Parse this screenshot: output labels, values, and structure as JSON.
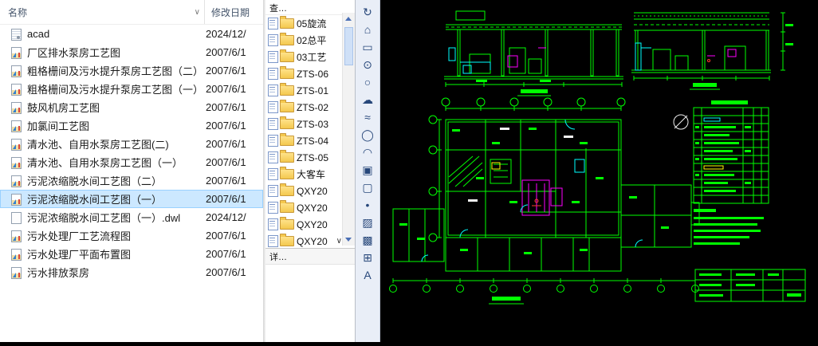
{
  "file_list": {
    "columns": {
      "name": "名称",
      "date": "修改日期"
    },
    "filter_glyph": "∨",
    "rows": [
      {
        "name": "acad",
        "date": "2024/12/",
        "icon": "acad"
      },
      {
        "name": "厂区排水泵房工艺图",
        "date": "2007/6/1",
        "icon": "dwg"
      },
      {
        "name": "粗格栅间及污水提升泵房工艺图（二）",
        "date": "2007/6/1",
        "icon": "dwg"
      },
      {
        "name": "粗格栅间及污水提升泵房工艺图（一）",
        "date": "2007/6/1",
        "icon": "dwg"
      },
      {
        "name": "鼓风机房工艺图",
        "date": "2007/6/1",
        "icon": "dwg"
      },
      {
        "name": "加氯间工艺图",
        "date": "2007/6/1",
        "icon": "dwg"
      },
      {
        "name": "清水池、自用水泵房工艺图(二)",
        "date": "2007/6/1",
        "icon": "dwg"
      },
      {
        "name": "清水池、自用水泵房工艺图（一）",
        "date": "2007/6/1",
        "icon": "dwg"
      },
      {
        "name": "污泥浓缩脱水间工艺图（二）",
        "date": "2007/6/1",
        "icon": "dwg"
      },
      {
        "name": "污泥浓缩脱水间工艺图（一）",
        "date": "2007/6/1",
        "icon": "dwg",
        "selected": true
      },
      {
        "name": "污泥浓缩脱水间工艺图（一）.dwl",
        "date": "2024/12/",
        "icon": "dwl"
      },
      {
        "name": "污水处理厂工艺流程图",
        "date": "2007/6/1",
        "icon": "dwg"
      },
      {
        "name": "污水处理厂平面布置图",
        "date": "2007/6/1",
        "icon": "dwg"
      },
      {
        "name": "污水排放泵房",
        "date": "2007/6/1",
        "icon": "dwg"
      }
    ]
  },
  "tree_panel": {
    "header": "查…",
    "details_header": "详…",
    "chevron_glyph": "∨",
    "items": [
      {
        "label": "05旋流"
      },
      {
        "label": "02总平"
      },
      {
        "label": "03工艺"
      },
      {
        "label": "ZTS-06"
      },
      {
        "label": "ZTS-01"
      },
      {
        "label": "ZTS-02"
      },
      {
        "label": "ZTS-03"
      },
      {
        "label": "ZTS-04"
      },
      {
        "label": "ZTS-05"
      },
      {
        "label": "大客车"
      },
      {
        "label": "QXY20"
      },
      {
        "label": "QXY20"
      },
      {
        "label": "QXY20"
      },
      {
        "label": "QXY20",
        "chevron": true
      }
    ]
  },
  "cad_toolbar": {
    "icons": [
      {
        "name": "orbit-icon",
        "glyph": "↻"
      },
      {
        "name": "home-icon",
        "glyph": "⌂"
      },
      {
        "name": "zoom-window-icon",
        "glyph": "▭"
      },
      {
        "name": "zoom-icon",
        "glyph": "⊙"
      },
      {
        "name": "circle-icon",
        "glyph": "○"
      },
      {
        "name": "revcloud-icon",
        "glyph": "☁"
      },
      {
        "name": "spline-icon",
        "glyph": "≈"
      },
      {
        "name": "ellipse-icon",
        "glyph": "◯"
      },
      {
        "name": "arc-icon",
        "glyph": "◠"
      },
      {
        "name": "insert-block-icon",
        "glyph": "▣"
      },
      {
        "name": "make-block-icon",
        "glyph": "▢"
      },
      {
        "name": "point-icon",
        "glyph": "•"
      },
      {
        "name": "hatch-icon",
        "glyph": "▨"
      },
      {
        "name": "gradient-icon",
        "glyph": "▩"
      },
      {
        "name": "table-icon",
        "glyph": "⊞"
      },
      {
        "name": "mtext-icon",
        "glyph": "A"
      }
    ]
  },
  "cad": {
    "background": "#000000",
    "colors": {
      "green": "#00ff00",
      "cyan": "#00ffff",
      "magenta": "#ff00ff",
      "red": "#ff3b30",
      "yellow": "#ffff00",
      "white": "#f2f2f2"
    }
  }
}
